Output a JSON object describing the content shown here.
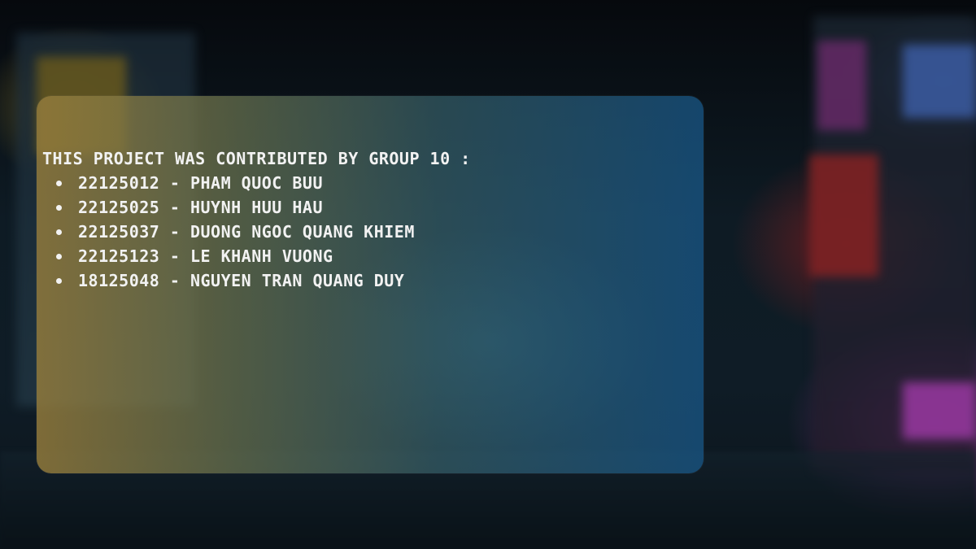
{
  "credits": {
    "heading": "THIS PROJECT WAS CONTRIBUTED BY GROUP 10 :",
    "members": [
      "22125012 - PHAM QUOC BUU",
      "22125025 - HUYNH HUU HAU",
      "22125037 - DUONG NGOC QUANG KHIEM",
      "22125123 - LE KHANH VUONG",
      "18125048 - NGUYEN TRAN QUANG DUY"
    ]
  }
}
